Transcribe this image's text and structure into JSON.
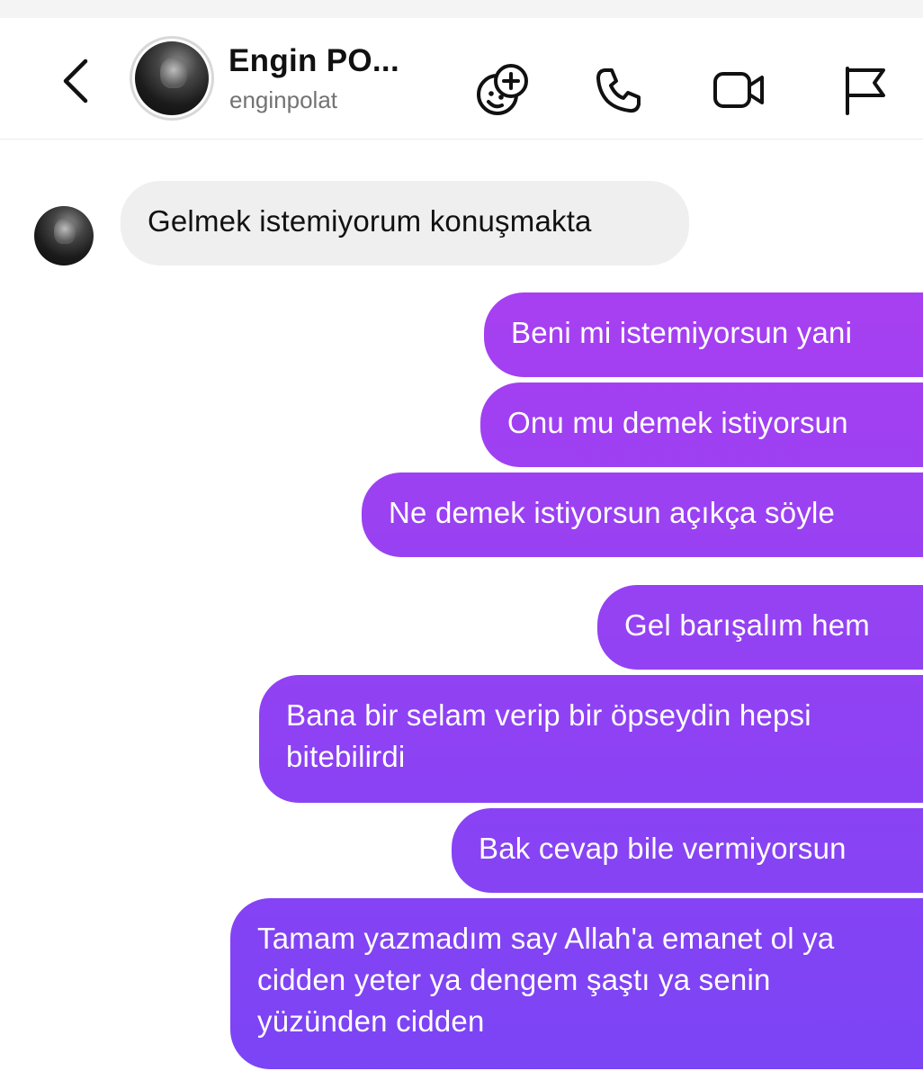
{
  "header": {
    "display_name": "Engin PO...",
    "username": "enginpolat",
    "icons": {
      "back": "chevron-left-icon",
      "effects": "sticker-add-icon",
      "call": "phone-icon",
      "video": "video-camera-icon",
      "report": "flag-icon"
    }
  },
  "messages": [
    {
      "direction": "incoming",
      "text": "Gelmek istemiyorum konuşmakta"
    },
    {
      "direction": "outgoing",
      "text": "Beni mi istemiyorsun yani"
    },
    {
      "direction": "outgoing",
      "text": "Onu mu demek istiyorsun"
    },
    {
      "direction": "outgoing",
      "text": "Ne demek istiyorsun açıkça söyle"
    },
    {
      "direction": "outgoing",
      "text": "Gel barışalım hem"
    },
    {
      "direction": "outgoing",
      "text": "Bana bir selam verip bir öpseydin hepsi bitebilirdi"
    },
    {
      "direction": "outgoing",
      "text": "Bak cevap bile vermiyorsun"
    },
    {
      "direction": "outgoing",
      "text": "Tamam yazmadım say Allah'a emanet ol ya cidden yeter ya dengem şaştı ya senin yüzünden cidden"
    }
  ],
  "colors": {
    "incoming_bubble": "#efefef",
    "outgoing_gradient_top": "#b03ff0",
    "outgoing_gradient_bottom": "#7a44f5",
    "text_primary": "#111111",
    "text_secondary": "#737373"
  }
}
